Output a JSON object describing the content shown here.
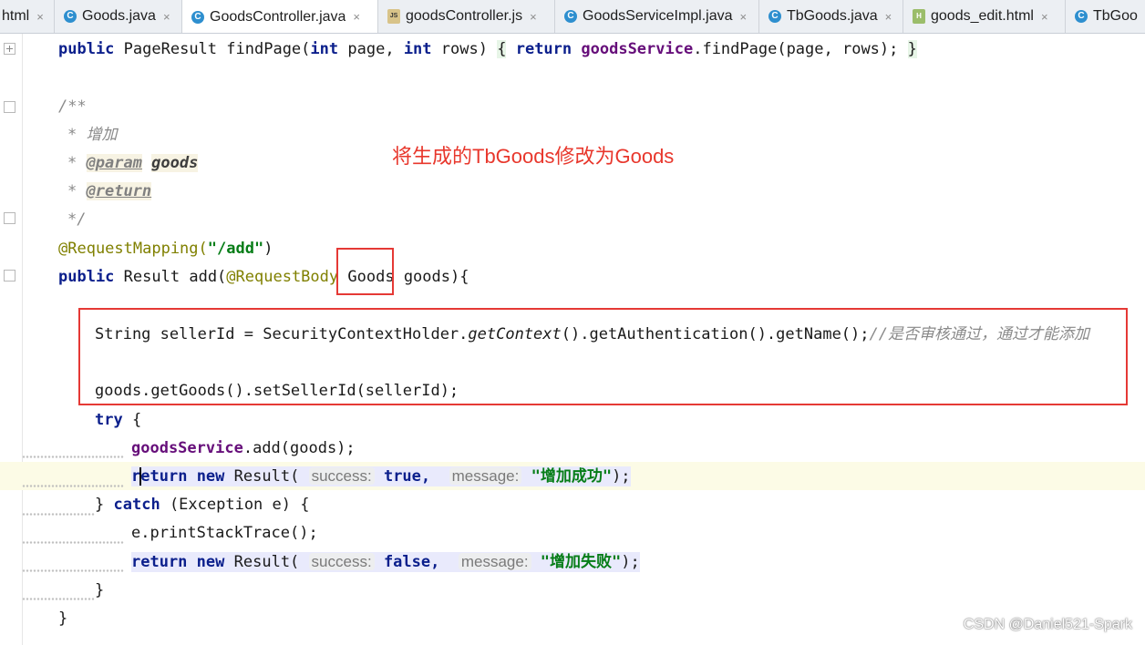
{
  "tabs": [
    {
      "label": "html",
      "icon": "",
      "active": false
    },
    {
      "label": "Goods.java",
      "icon": "class-icon",
      "active": false
    },
    {
      "label": "GoodsController.java",
      "icon": "class-icon",
      "active": true
    },
    {
      "label": "goodsController.js",
      "icon": "js-file-icon",
      "active": false
    },
    {
      "label": "GoodsServiceImpl.java",
      "icon": "class-icon",
      "active": false
    },
    {
      "label": "TbGoods.java",
      "icon": "class-icon",
      "active": false
    },
    {
      "label": "goods_edit.html",
      "icon": "html-file-icon",
      "active": false
    },
    {
      "label": "TbGoo",
      "icon": "class-icon",
      "active": false
    }
  ],
  "tab_close_glyph": "×",
  "code": {
    "findpage": {
      "public": "public",
      "type": "PageResult",
      "method": "findPage(",
      "int1": "int",
      "arg1": "page,",
      "int2": "int",
      "arg2": "rows)",
      "open": "{",
      "ret": "return",
      "svc": "goodsService",
      "call": ".findPage(page, rows);",
      "close": "}"
    },
    "doc_open": "/**",
    "doc_desc": "* 增加",
    "doc_star1": "*",
    "doc_param_tag": "@param",
    "doc_param_name": "goods",
    "doc_star2": "*",
    "doc_return_tag": "@return",
    "doc_close": "*/",
    "mapping": {
      "annotation": "@RequestMapping(",
      "path": "\"/add\"",
      "close": ")"
    },
    "add_sig": {
      "public": "public",
      "result": "Result",
      "method": "add(",
      "annotation": "@RequestBody",
      "type": "Goods",
      "rest": "goods){"
    },
    "seller_line": "String sellerId = SecurityContextHolder.",
    "seller_ctx": "getContext",
    "seller_rest": "().getAuthentication().getName();",
    "seller_comment": "//是否审核通过，通过才能添加",
    "set_seller_line": "goods.getGoods().setSellerId(sellerId);",
    "try_kw": "try",
    "try_brace": "{",
    "svc_field": "goodsService",
    "svc_call": ".add(goods);",
    "return1": {
      "ret_start": "r",
      "ret_end": "eturn",
      "new": "new",
      "result": "Result(",
      "hint_success": "success:",
      "value": "true,",
      "hint_message": "message:",
      "message": "\"增加成功\"",
      "end": ");"
    },
    "catch_close": "}",
    "catch_kw": "catch",
    "catch_rest": "(Exception e) {",
    "print_trace": "e.printStackTrace();",
    "return2": {
      "ret": "return",
      "new": "new",
      "result": "Result(",
      "hint_success": "success:",
      "value": "false,",
      "hint_message": "message:",
      "message": "\"增加失败\"",
      "end": ");"
    },
    "inner_close": "}",
    "outer_close": "}"
  },
  "annotation_note": "将生成的TbGoods修改为Goods",
  "watermark": "CSDN @Daniel521-Spark",
  "colors": {
    "keyword": "#0b1f8c",
    "field": "#660e7a",
    "annotation": "#808000",
    "string": "#067d17",
    "comment": "#8a8a8a",
    "red_box": "#e53935",
    "note_text": "#e8372c"
  }
}
